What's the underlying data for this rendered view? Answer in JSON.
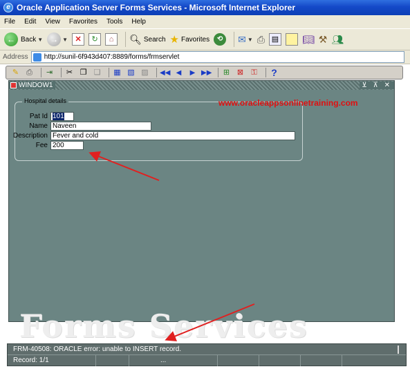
{
  "window_title": "Oracle Application Server Forms Services - Microsoft Internet Explorer",
  "menu": [
    "File",
    "Edit",
    "View",
    "Favorites",
    "Tools",
    "Help"
  ],
  "toolbar": {
    "back_label": "Back",
    "search_label": "Search",
    "favorites_label": "Favorites"
  },
  "address": {
    "label": "Address",
    "url": "http://sunil-6f943d407:8889/forms/frmservlet"
  },
  "form_window": {
    "title": "WINDOW1",
    "controls": "⊻ ⊼ ✕"
  },
  "hospital": {
    "frame_title": "Hospital details",
    "pat_id_label": "Pat Id",
    "pat_id_value": "101",
    "name_label": "Name",
    "name_value": "Naveen",
    "description_label": "Description",
    "description_value": "Fever and cold",
    "fee_label": "Fee",
    "fee_value": "200"
  },
  "site_link": "www.oracleappsonlinetraining.com",
  "watermark": "Forms Services",
  "status": {
    "message": "FRM-40508: ORACLE error: unable to INSERT record.",
    "record": "Record: 1/1",
    "ellipsis": "..."
  },
  "colors": {
    "form_bg": "#6b8583",
    "link": "#e01010",
    "arrow": "#e02020"
  }
}
